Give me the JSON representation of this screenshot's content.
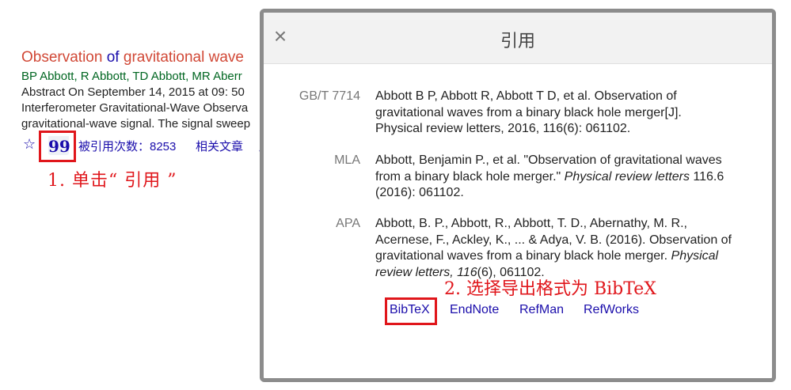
{
  "result": {
    "title_part1": "Observation",
    "title_of": "of",
    "title_part2": "gravitational wave",
    "authors": "BP Abbott, R Abbott, TD Abbott, MR Aberr",
    "snippet_line1": "Abstract On September 14, 2015 at 09: 50",
    "snippet_line2": "Interferometer Gravitational-Wave Observa",
    "snippet_line3": "gravitational-wave signal. The signal sweep",
    "star_icon": "☆",
    "cite_icon": "99",
    "cited_by": "被引用次数：8253",
    "related": "相关文章",
    "more": "所"
  },
  "annotations": {
    "step1": "1. 单击“ 引用 ”",
    "step2": "2. 选择导出格式为 BibTeX",
    "color": "#e0161b"
  },
  "dialog": {
    "title": "引用",
    "close_icon": "×",
    "citations": [
      {
        "label": "GB/T 7714",
        "text": "Abbott B P, Abbott R, Abbott T D, et al. Observation of gravitational waves from a binary black hole merger[J]. Physical review letters, 2016, 116(6): 061102."
      },
      {
        "label": "MLA",
        "text_pre": "Abbott, Benjamin P., et al. \"Observation of gravitational waves from a binary black hole merger.\" ",
        "text_italic": "Physical review letters",
        "text_post": " 116.6 (2016): 061102."
      },
      {
        "label": "APA",
        "text_pre": "Abbott, B. P., Abbott, R., Abbott, T. D., Abernathy, M. R., Acernese, F., Ackley, K., ... & Adya, V. B. (2016). Observation of gravitational waves from a binary black hole merger. ",
        "text_italic": "Physical review letters, 116",
        "text_post": "(6), 061102."
      }
    ],
    "exports": [
      "BibTeX",
      "EndNote",
      "RefMan",
      "RefWorks"
    ]
  }
}
